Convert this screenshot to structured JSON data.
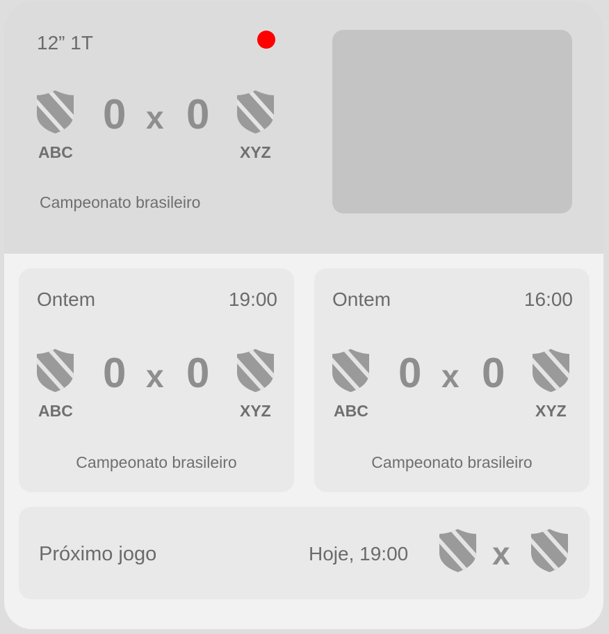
{
  "live": {
    "clock": "12” 1T",
    "status_color": "#ff0000",
    "home_team": "ABC",
    "away_team": "XYZ",
    "home_score": "0",
    "separator": "x",
    "away_score": "0",
    "competition": "Campeonato brasileiro"
  },
  "recent": [
    {
      "day": "Ontem",
      "time": "19:00",
      "home_team": "ABC",
      "away_team": "XYZ",
      "home_score": "0",
      "separator": "x",
      "away_score": "0",
      "competition": "Campeonato brasileiro"
    },
    {
      "day": "Ontem",
      "time": "16:00",
      "home_team": "ABC",
      "away_team": "XYZ",
      "home_score": "0",
      "separator": "x",
      "away_score": "0",
      "competition": "Campeonato brasileiro"
    }
  ],
  "next": {
    "label": "Próximo jogo",
    "time": "Hoje, 19:00",
    "separator": "x"
  },
  "icons": {
    "team_crest": "shield-icon"
  },
  "colors": {
    "crest": "#9a9a9a",
    "live": "#ff0000"
  }
}
